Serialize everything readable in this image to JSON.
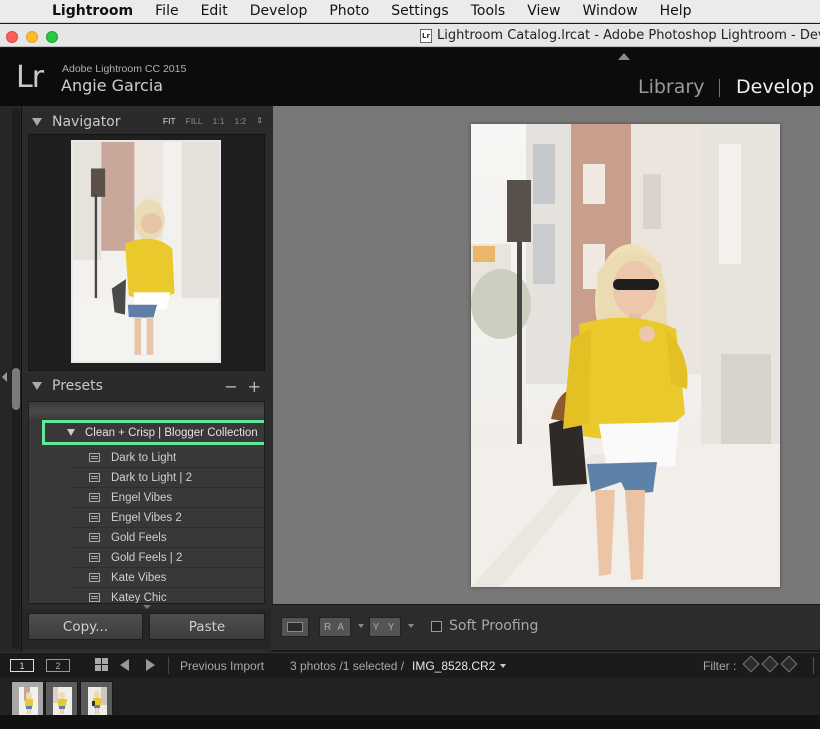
{
  "menubar": {
    "app_name": "Lightroom",
    "items": [
      "File",
      "Edit",
      "Develop",
      "Photo",
      "Settings",
      "Tools",
      "View",
      "Window",
      "Help"
    ]
  },
  "window": {
    "doc_icon_text": "Lr",
    "title": "Lightroom Catalog.lrcat - Adobe Photoshop Lightroom - Develo"
  },
  "identity": {
    "logo": "Lr",
    "product": "Adobe Lightroom CC 2015",
    "user": "Angie Garcia"
  },
  "modules": {
    "library": "Library",
    "develop": "Develop"
  },
  "navigator": {
    "title": "Navigator",
    "zoom_options": [
      "FIT",
      "FILL",
      "1:1",
      "1:2"
    ],
    "zoom_selected": "FIT",
    "zoom_stepper": "⇕"
  },
  "presets": {
    "title": "Presets",
    "remove_label": "−",
    "add_label": "+",
    "folder": "Clean + Crisp | Blogger Collection",
    "highlight_color": "#5fe89b",
    "items": [
      "Dark to Light",
      "Dark to Light | 2",
      "Engel Vibes",
      "Engel Vibes 2",
      "Gold Feels",
      "Gold Feels | 2",
      "Kate Vibes",
      "Katey Chic"
    ]
  },
  "left_buttons": {
    "copy": "Copy...",
    "paste": "Paste"
  },
  "toolbar": {
    "before_after_ra": "R A",
    "before_after_yy": "Y Y",
    "soft_proofing": "Soft Proofing",
    "soft_proofing_checked": false
  },
  "filmbar": {
    "screen1": "1",
    "screen2": "2",
    "source": "Previous Import",
    "count": "3 photos /1 selected /",
    "file": "IMG_8528.CR2",
    "filter_label": "Filter :"
  },
  "filmstrip": {
    "thumbnail_count": 3,
    "selected_index": 0
  },
  "colors": {
    "sweater_yellow": "#e9c92c",
    "panel_bg": "#2b2b2b",
    "canvas_bg": "#787878"
  }
}
